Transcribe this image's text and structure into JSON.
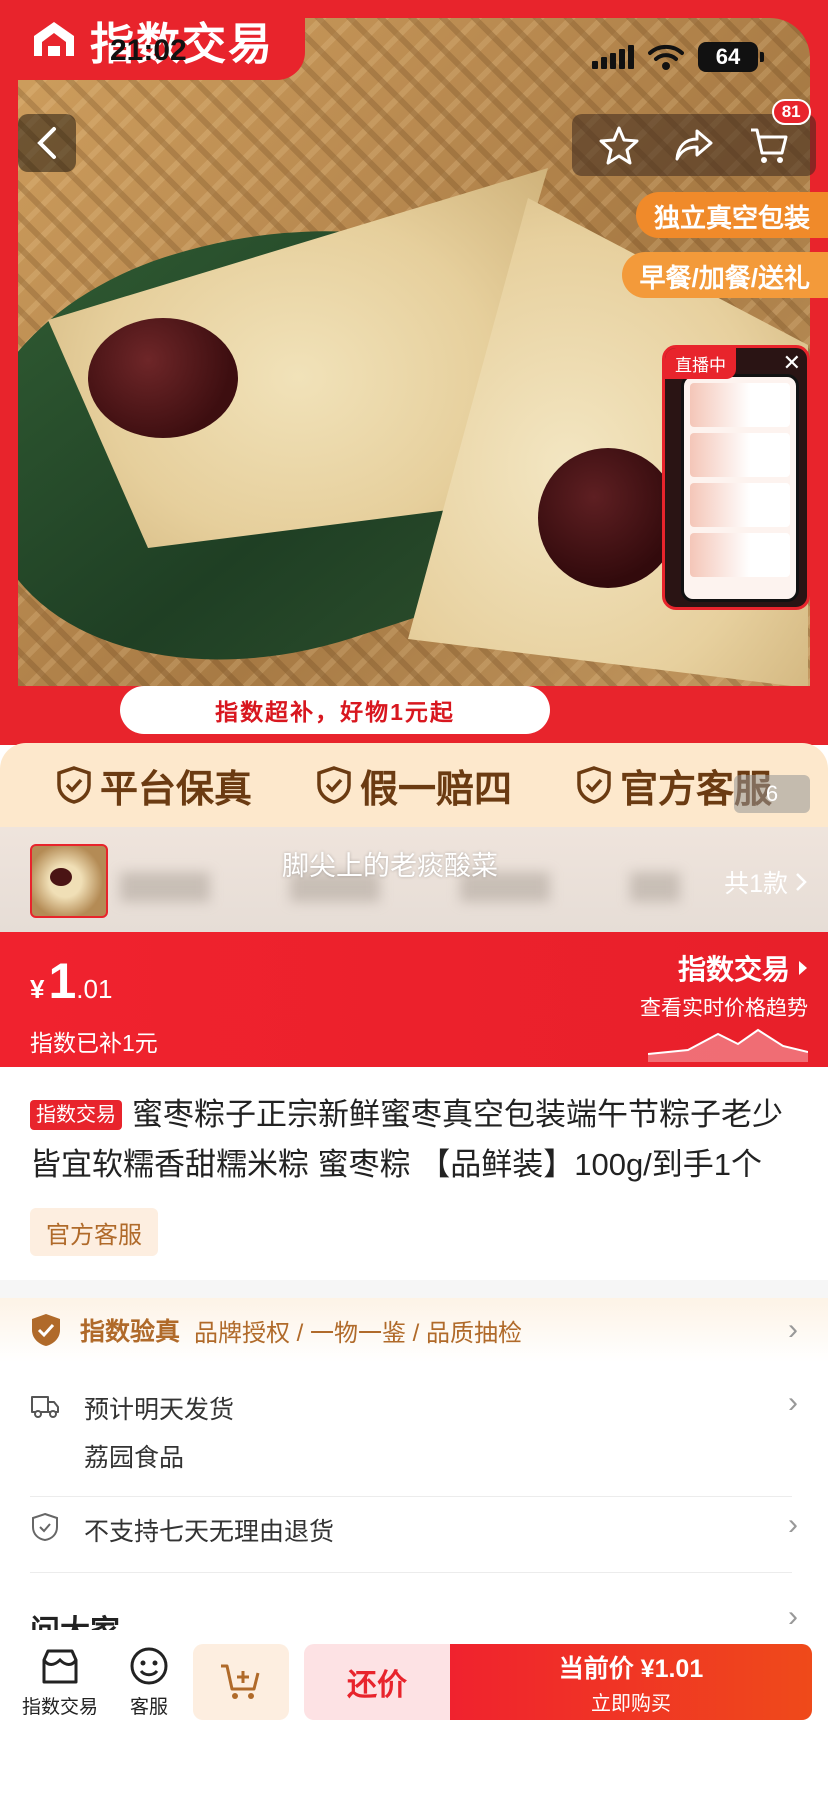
{
  "status_bar": {
    "time": "21:02",
    "battery": "64"
  },
  "brand": {
    "name": "指数交易"
  },
  "header": {
    "cart_badge": "81"
  },
  "hero": {
    "tags": [
      "独立真空包装",
      "早餐/加餐/送礼"
    ],
    "live_label": "直播中",
    "banner_text": "指数超补，好物1元起",
    "image_counter": "6"
  },
  "guarantees": [
    "平台保真",
    "假一赔四",
    "官方客服"
  ],
  "variant": {
    "title": "脚尖上的老痰酸菜",
    "count": "共1款"
  },
  "price_bar": {
    "currency": "¥",
    "price_int": "1",
    "price_dec": ".01",
    "subsidy": "指数已补1元",
    "right_title": "指数交易",
    "right_sub": "查看实时价格趋势"
  },
  "product": {
    "badge": "指数交易",
    "title": "蜜枣粽子正宗新鲜蜜枣真空包装端午节粽子老少皆宜软糯香甜糯米粽 蜜枣粽 【品鲜装】100g/到手1个",
    "service_chip": "官方客服"
  },
  "verify": {
    "title": "指数验真",
    "desc": "品牌授权 / 一物一鉴 / 品质抽检"
  },
  "shipping": {
    "text": "预计明天发货",
    "seller": "荔园食品"
  },
  "returns": {
    "text": "不支持七天无理由退货"
  },
  "ask": {
    "title": "问大家"
  },
  "bottom_bar": {
    "home_label": "指数交易",
    "service_label": "客服",
    "bargain_label": "还价",
    "buy_line1": "当前价 ¥1.01",
    "buy_line2": "立即购买"
  },
  "colors": {
    "brand_red": "#e8242c",
    "guarantee_bg": "#fde8cc",
    "accent_brown": "#b06a2a"
  }
}
